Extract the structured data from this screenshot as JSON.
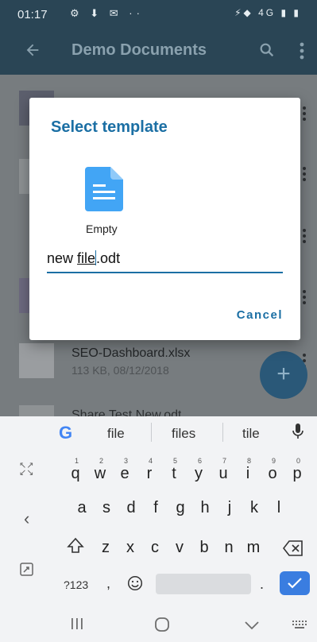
{
  "status_bar": {
    "time": "01:17",
    "left_icons": "⚙ ⬇ ✉ ··",
    "right_icons": "⚡◆ 4G ▮ ▮"
  },
  "app_bar": {
    "title": "Demo Documents",
    "back_icon": "arrow-left",
    "search_icon": "search",
    "menu_icon": "more-vertical"
  },
  "list": {
    "items": [
      {
        "name": "SEO-Dashboard.xlsx",
        "meta": "113 KB, 08/12/2018"
      },
      {
        "name": "Share Test New.odt",
        "meta": ""
      }
    ],
    "fab_label": "+"
  },
  "dialog": {
    "title": "Select template",
    "template_label": "Empty",
    "filename_before": "new ",
    "filename_selected": "file",
    "filename_after": ".odt",
    "cancel_label": "Cancel"
  },
  "keyboard": {
    "suggestions": [
      "file",
      "files",
      "tile"
    ],
    "row1": [
      "q",
      "w",
      "e",
      "r",
      "t",
      "y",
      "u",
      "i",
      "o",
      "p"
    ],
    "row1_hints": [
      "1",
      "2",
      "3",
      "4",
      "5",
      "6",
      "7",
      "8",
      "9",
      "0"
    ],
    "row2": [
      "a",
      "s",
      "d",
      "f",
      "g",
      "h",
      "j",
      "k",
      "l"
    ],
    "row3": [
      "z",
      "x",
      "c",
      "v",
      "b",
      "n",
      "m"
    ],
    "symbols_label": "?123",
    "comma": ",",
    "period": ".",
    "colors": {
      "enter": "#3a7de0",
      "accent": "#1b6fa4"
    }
  }
}
